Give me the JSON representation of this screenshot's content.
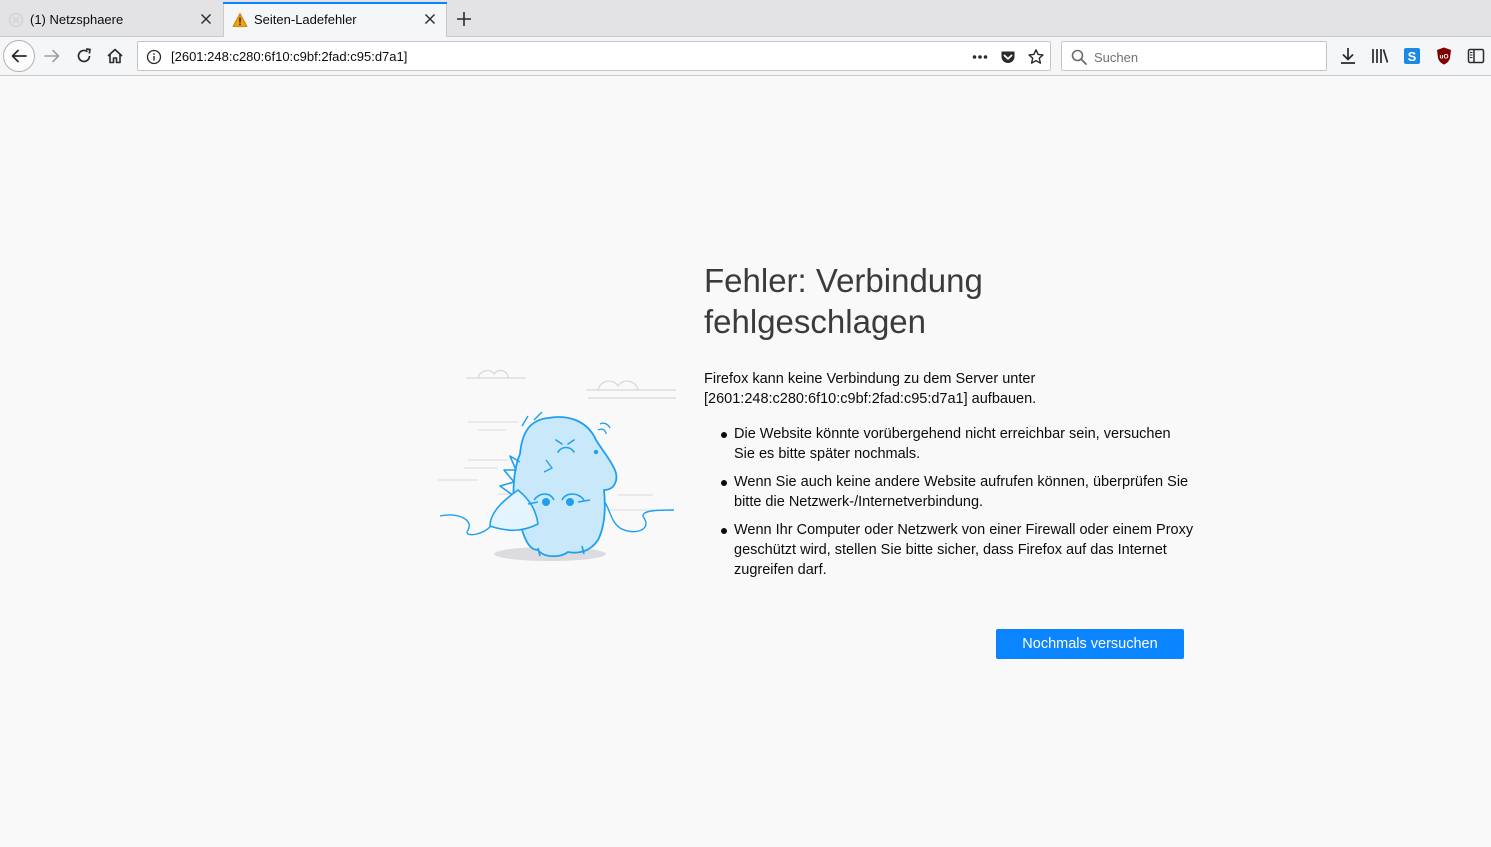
{
  "tabs": [
    {
      "label": "(1) Netzsphaere",
      "favicon": "netzsphaere-favicon",
      "active": false
    },
    {
      "label": "Seiten-Ladefehler",
      "favicon": "warning-icon",
      "active": true
    }
  ],
  "urlbar": {
    "url": "[2601:248:c280:6f10:c9bf:2fad:c95:d7a1]"
  },
  "searchbar": {
    "placeholder": "Suchen"
  },
  "error": {
    "title": "Fehler: Verbindung fehlgeschlagen",
    "description_line1": "Firefox kann keine Verbindung zu dem Server unter",
    "description_line2": "[2601:248:c280:6f10:c9bf:2fad:c95:d7a1] aufbauen.",
    "hints": [
      "Die Website könnte vorübergehend nicht erreichbar sein, versuchen Sie es bitte später nochmals.",
      "Wenn Sie auch keine andere Website aufrufen können, überprüfen Sie bitte die Netzwerk-/Internetverbindung.",
      "Wenn Ihr Computer oder Netzwerk von einer Firewall oder einem Proxy geschützt wird, stellen Sie bitte sicher, dass Firefox auf das Internet zugreifen darf."
    ],
    "retry_label": "Nochmals versuchen"
  },
  "colors": {
    "accent": "#0a84ff",
    "illustration": "#1ea0f0",
    "warning": "#e8a700"
  }
}
